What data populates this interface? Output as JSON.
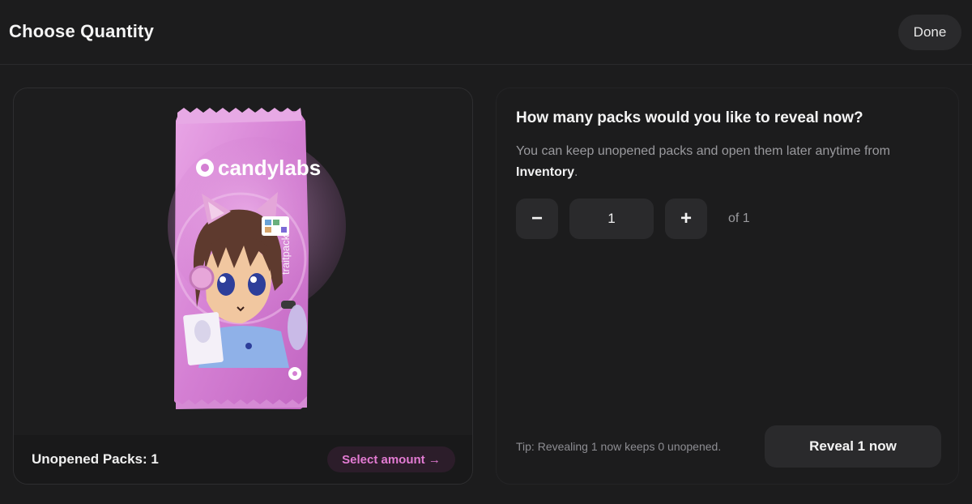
{
  "header": {
    "title": "Choose Quantity",
    "done_label": "Done"
  },
  "pack": {
    "brand_text": "candylabs",
    "side_text": "traitpack",
    "unopened_label": "Unopened Packs: 1",
    "select_amount_label": "Select amount →",
    "accent_color": "#e37bd3",
    "pack_color": "#d98bd8"
  },
  "reveal": {
    "question": "How many packs would you like to reveal now?",
    "desc_before": "You can keep unopened packs and open them later anytime from ",
    "desc_link": "Inventory",
    "desc_after": ".",
    "decrement_label": "−",
    "increment_label": "+",
    "quantity_value": "1",
    "of_label": "of 1",
    "tip": "Tip: Revealing 1 now keeps 0 unopened.",
    "reveal_button_label": "Reveal 1 now"
  }
}
